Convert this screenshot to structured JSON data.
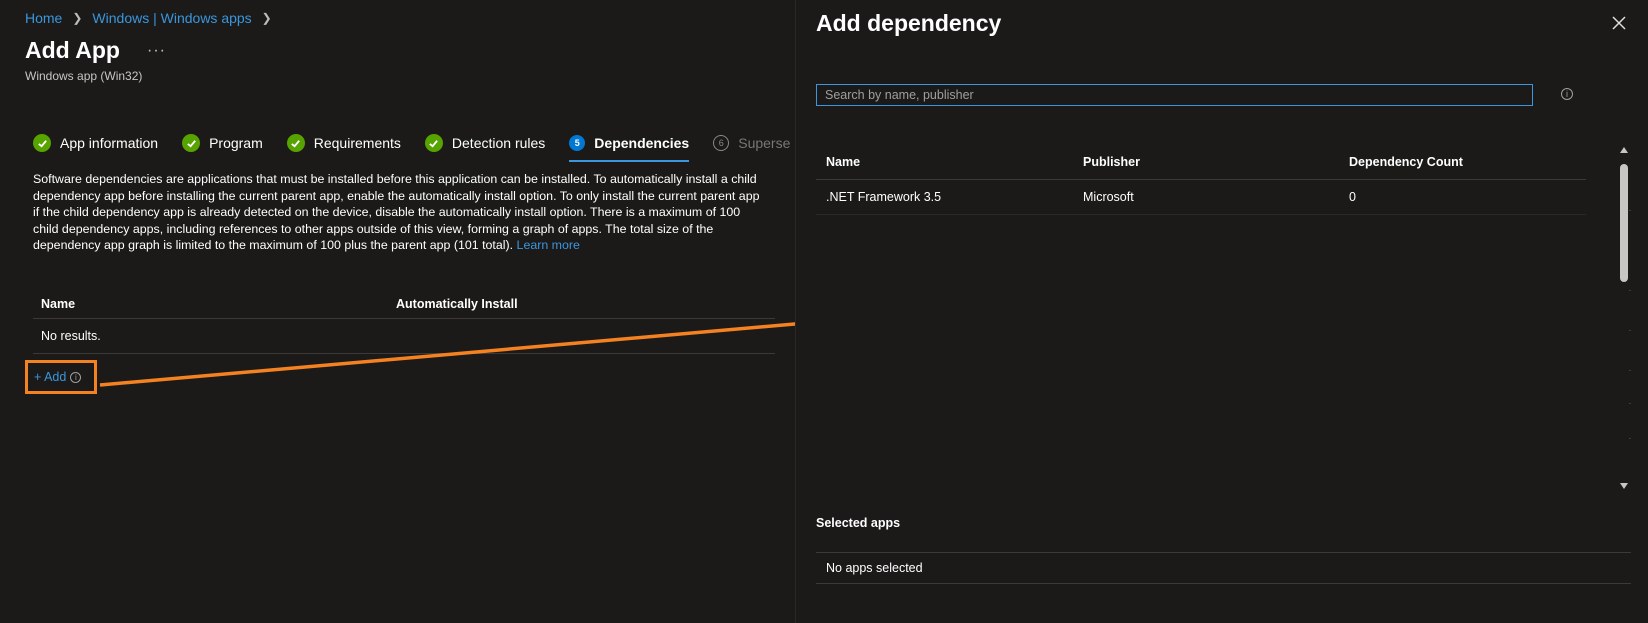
{
  "breadcrumb": {
    "home": "Home",
    "windows_apps": "Windows | Windows apps"
  },
  "page": {
    "title": "Add App",
    "more": "···",
    "subtitle": "Windows app (Win32)"
  },
  "steps": [
    {
      "label": "App information",
      "state": "done"
    },
    {
      "label": "Program",
      "state": "done"
    },
    {
      "label": "Requirements",
      "state": "done"
    },
    {
      "label": "Detection rules",
      "state": "done"
    },
    {
      "label": "Dependencies",
      "state": "active",
      "number": "5"
    },
    {
      "label": "Superse",
      "state": "todo",
      "number": "6"
    }
  ],
  "description": {
    "text": "Software dependencies are applications that must be installed before this application can be installed. To automatically install a child dependency app before installing the current parent app, enable the automatically install option. To only install the current parent app if the child dependency app is already detected on the device, disable the automatically install option. There is a maximum of 100 child dependency apps, including references to other apps outside of this view, forming a graph of apps. The total size of the dependency app graph is limited to the maximum of 100 plus the parent app (101 total).",
    "learn_more": "Learn more"
  },
  "dependencies_table": {
    "col_name": "Name",
    "col_auto": "Automatically Install",
    "empty": "No results."
  },
  "add_link": "+ Add",
  "panel": {
    "title": "Add dependency",
    "search_placeholder": "Search by name, publisher",
    "columns": {
      "name": "Name",
      "publisher": "Publisher",
      "count": "Dependency Count"
    },
    "rows": [
      {
        "name": ".NET Framework 3.5",
        "publisher": "Microsoft",
        "count": "0"
      }
    ],
    "selected_label": "Selected apps",
    "selected_empty": "No apps selected"
  },
  "colors": {
    "accent": "#0078d4",
    "link": "#3a96dd",
    "success": "#57a300",
    "annotation": "#f58220",
    "background": "#1b1a19"
  }
}
